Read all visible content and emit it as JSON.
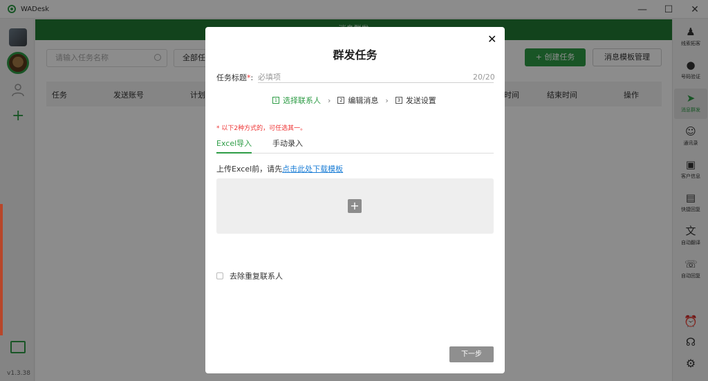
{
  "window": {
    "title": "WADesk",
    "minimize": "—",
    "maximize": "☐",
    "close": "✕"
  },
  "left_rail": {
    "version": "v1.3.38",
    "add": "+"
  },
  "header": {
    "banner": "消息群发"
  },
  "toolbar": {
    "search_placeholder": "请输入任务名称",
    "filter_value": "全部任",
    "create_label": "+ 创建任务",
    "template_label": "消息模板管理"
  },
  "table": {
    "columns": [
      "任务",
      "发送账号",
      "计划",
      "时间",
      "结束时间",
      "操作"
    ]
  },
  "right_rail": {
    "items": [
      {
        "label": "线索拓客",
        "icon": "user-search-icon"
      },
      {
        "label": "号码验证",
        "icon": "user-verify-icon"
      },
      {
        "label": "消息群发",
        "icon": "send-icon"
      },
      {
        "label": "通讯录",
        "icon": "contacts-icon"
      },
      {
        "label": "客户信息",
        "icon": "customer-card-icon"
      },
      {
        "label": "快捷回复",
        "icon": "quick-reply-icon"
      },
      {
        "label": "自动翻译",
        "icon": "translate-icon"
      },
      {
        "label": "自动回复",
        "icon": "auto-reply-icon"
      }
    ],
    "bottom": [
      "alarm-icon",
      "headset-icon",
      "settings-icon"
    ]
  },
  "modal": {
    "title": "群发任务",
    "close": "✕",
    "field_label": "任务标题",
    "field_required": "*",
    "field_colon": ":",
    "field_placeholder": "必填项",
    "field_count": "20/20",
    "steps": [
      {
        "num": "1",
        "label": "选择联系人"
      },
      {
        "num": "2",
        "label": "编辑消息"
      },
      {
        "num": "3",
        "label": "发送设置"
      }
    ],
    "step_arrow": "›",
    "notice": "* 以下2种方式的，可任选其一。",
    "tabs": [
      "Excel导入",
      "手动录入"
    ],
    "upload_hint": "上传Excel前，请先",
    "upload_link": "点击此处下载模板",
    "upload_plus": "+",
    "dedup_label": "去除重复联系人",
    "next_label": "下一步"
  },
  "colors": {
    "accent": "#2e9c46",
    "banner": "#217a34",
    "link": "#1e7fd6",
    "warning": "#e33333"
  }
}
